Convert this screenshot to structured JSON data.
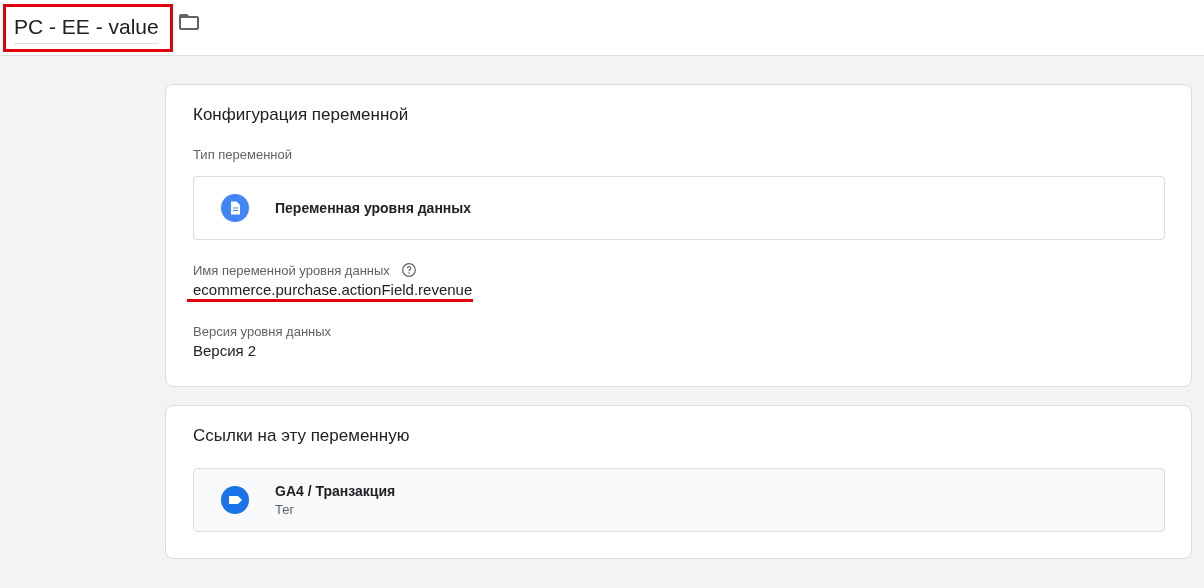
{
  "header": {
    "title": "PC - EE - value",
    "title_highlighted": true
  },
  "config_card": {
    "title": "Конфигурация переменной",
    "type_label": "Тип переменной",
    "type_value": "Переменная уровня данных",
    "fields": [
      {
        "label": "Имя переменной уровня данных",
        "help": true,
        "value": "ecommerce.purchase.actionField.revenue",
        "highlighted": true
      },
      {
        "label": "Версия уровня данных",
        "help": false,
        "value": "Версия 2",
        "highlighted": false
      }
    ]
  },
  "references_card": {
    "title": "Ссылки на эту переменную",
    "items": [
      {
        "kind": "tag",
        "name": "GA4 / Транзакция",
        "subtitle": "Тег"
      }
    ]
  }
}
